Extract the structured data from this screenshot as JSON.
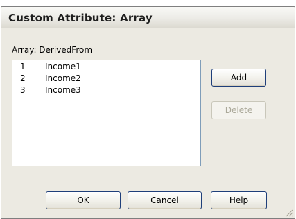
{
  "window": {
    "title": "Custom Attribute: Array"
  },
  "array_label": "Array: DerivedFrom",
  "list": {
    "items": [
      {
        "num": "1",
        "value": "Income1"
      },
      {
        "num": "2",
        "value": "Income2"
      },
      {
        "num": "3",
        "value": "Income3"
      }
    ]
  },
  "buttons": {
    "add": "Add",
    "delete": "Delete",
    "ok": "OK",
    "cancel": "Cancel",
    "help": "Help"
  },
  "colors": {
    "dialog_bg": "#eceae2",
    "button_border": "#1f3f7a",
    "list_border": "#7f9db9",
    "disabled_text": "#aaa899"
  },
  "icons": {
    "resize": "resize-grip-icon"
  }
}
